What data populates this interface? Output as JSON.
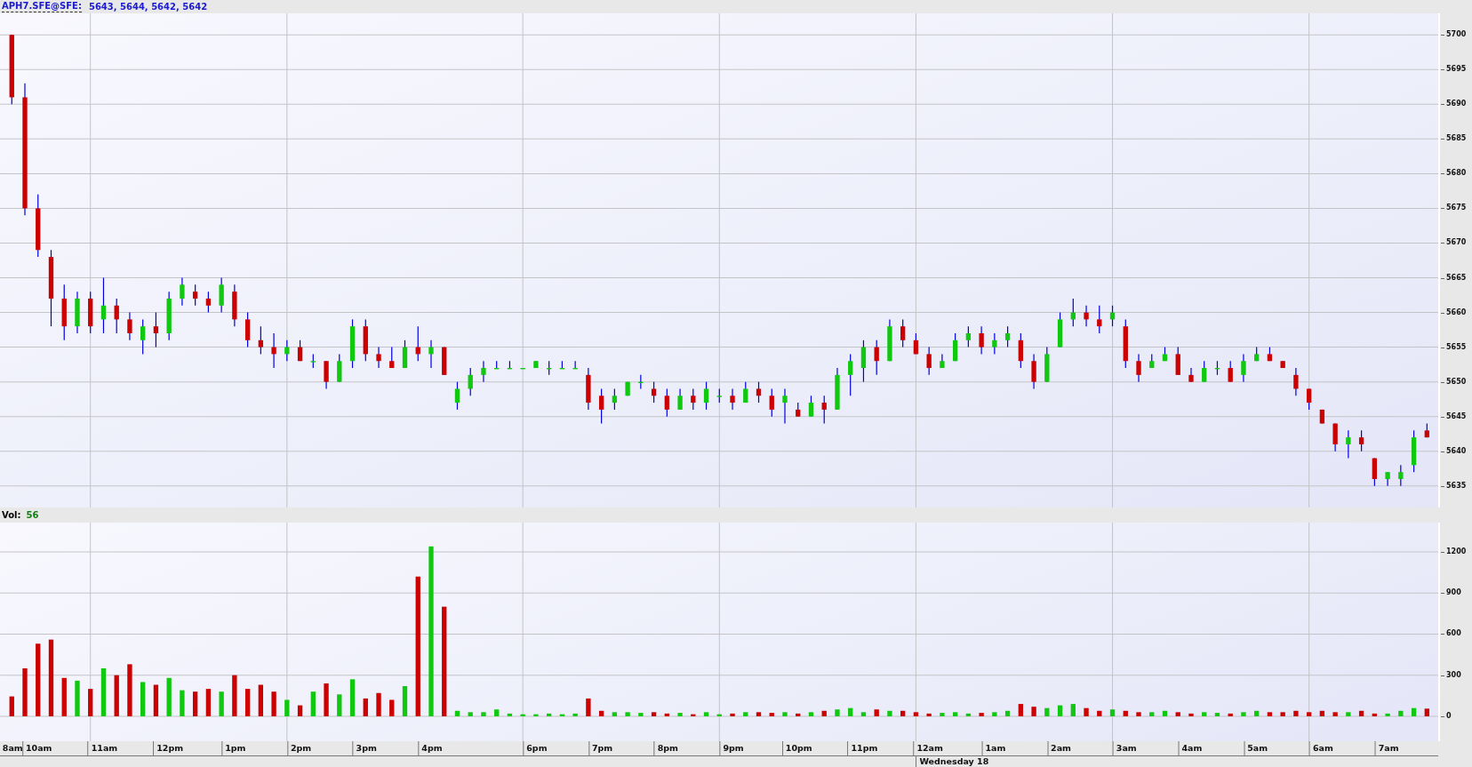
{
  "header": {
    "symbol": "APH7.SFE@SFE:",
    "quote": "5643, 5644, 5642, 5642"
  },
  "price_chart": {
    "chart_data": {
      "type": "candlestick",
      "ylim": [
        5631.9,
        5703.1
      ],
      "yticks": [
        5635,
        5640,
        5645,
        5650,
        5655,
        5660,
        5665,
        5670,
        5675,
        5680,
        5685,
        5690,
        5695,
        5700
      ],
      "grid": true,
      "categories": [
        null,
        null,
        null,
        null,
        null,
        null,
        null,
        null,
        null,
        null,
        null,
        null,
        null,
        null,
        null,
        null,
        null,
        null,
        null,
        null,
        null,
        null,
        null,
        null,
        null,
        null,
        null,
        null,
        null,
        null,
        null,
        null,
        null,
        null,
        null,
        null,
        null,
        null,
        null,
        null,
        null,
        null,
        null,
        null,
        null,
        null,
        null,
        null,
        null,
        null,
        null,
        null,
        null,
        null,
        null,
        null,
        null,
        null,
        null,
        null,
        null,
        null,
        null,
        null,
        null,
        null,
        null,
        null,
        null,
        null,
        null,
        null,
        null,
        null,
        null,
        null,
        null,
        null,
        null,
        null,
        null,
        null,
        null,
        null,
        null,
        null,
        null,
        null,
        null,
        null,
        null,
        null,
        null,
        null,
        null,
        null,
        null,
        null,
        null,
        null,
        null,
        null,
        null,
        null,
        null,
        null,
        null,
        null,
        null
      ],
      "ohlc": [
        [
          5700,
          5700,
          5690,
          5691
        ],
        [
          5691,
          5693,
          5674,
          5675
        ],
        [
          5675,
          5677,
          5668,
          5669
        ],
        [
          5668,
          5669,
          5658,
          5662
        ],
        [
          5662,
          5664,
          5656,
          5658
        ],
        [
          5658,
          5663,
          5657,
          5662
        ],
        [
          5662,
          5663,
          5657,
          5658
        ],
        [
          5659,
          5665,
          5657,
          5661
        ],
        [
          5661,
          5662,
          5657,
          5659
        ],
        [
          5659,
          5660,
          5656,
          5657
        ],
        [
          5656,
          5659,
          5654,
          5658
        ],
        [
          5658,
          5660,
          5655,
          5657
        ],
        [
          5657,
          5663,
          5656,
          5662
        ],
        [
          5662,
          5665,
          5661,
          5664
        ],
        [
          5663,
          5664,
          5661,
          5662
        ],
        [
          5662,
          5663,
          5660,
          5661
        ],
        [
          5661,
          5665,
          5660,
          5664
        ],
        [
          5663,
          5664,
          5658,
          5659
        ],
        [
          5659,
          5660,
          5655,
          5656
        ],
        [
          5656,
          5658,
          5654,
          5655
        ],
        [
          5655,
          5657,
          5652,
          5654
        ],
        [
          5654,
          5656,
          5653,
          5655
        ],
        [
          5655,
          5656,
          5653,
          5653
        ],
        [
          5653,
          5654,
          5652,
          5653
        ],
        [
          5653,
          5653,
          5649,
          5650
        ],
        [
          5650,
          5654,
          5650,
          5653
        ],
        [
          5653,
          5659,
          5652,
          5658
        ],
        [
          5658,
          5659,
          5653,
          5654
        ],
        [
          5654,
          5655,
          5652,
          5653
        ],
        [
          5653,
          5655,
          5652,
          5652
        ],
        [
          5652,
          5656,
          5652,
          5655
        ],
        [
          5655,
          5658,
          5653,
          5654
        ],
        [
          5654,
          5656,
          5652,
          5655
        ],
        [
          5655,
          5655,
          5651,
          5651
        ],
        [
          5647,
          5650,
          5646,
          5649
        ],
        [
          5649,
          5652,
          5648,
          5651
        ],
        [
          5651,
          5653,
          5650,
          5652
        ],
        [
          5652,
          5653,
          5652,
          5652
        ],
        [
          5652,
          5653,
          5652,
          5652
        ],
        [
          5652,
          5652,
          5652,
          5652
        ],
        [
          5652,
          5653,
          5652,
          5653
        ],
        [
          5652,
          5653,
          5651,
          5652
        ],
        [
          5652,
          5653,
          5652,
          5652
        ],
        [
          5652,
          5653,
          5652,
          5652
        ],
        [
          5651,
          5652,
          5646,
          5647
        ],
        [
          5648,
          5649,
          5644,
          5646
        ],
        [
          5647,
          5649,
          5646,
          5648
        ],
        [
          5648,
          5650,
          5648,
          5650
        ],
        [
          5650,
          5651,
          5649,
          5650
        ],
        [
          5649,
          5650,
          5647,
          5648
        ],
        [
          5648,
          5649,
          5645,
          5646
        ],
        [
          5646,
          5649,
          5646,
          5648
        ],
        [
          5648,
          5649,
          5646,
          5647
        ],
        [
          5647,
          5650,
          5646,
          5649
        ],
        [
          5648,
          5649,
          5647,
          5648
        ],
        [
          5648,
          5649,
          5646,
          5647
        ],
        [
          5647,
          5650,
          5647,
          5649
        ],
        [
          5649,
          5650,
          5647,
          5648
        ],
        [
          5648,
          5649,
          5645,
          5646
        ],
        [
          5647,
          5649,
          5644,
          5648
        ],
        [
          5646,
          5647,
          5645,
          5645
        ],
        [
          5645,
          5648,
          5645,
          5647
        ],
        [
          5647,
          5648,
          5644,
          5646
        ],
        [
          5646,
          5652,
          5646,
          5651
        ],
        [
          5651,
          5654,
          5648,
          5653
        ],
        [
          5652,
          5656,
          5650,
          5655
        ],
        [
          5655,
          5656,
          5651,
          5653
        ],
        [
          5653,
          5659,
          5653,
          5658
        ],
        [
          5658,
          5659,
          5655,
          5656
        ],
        [
          5656,
          5657,
          5654,
          5654
        ],
        [
          5654,
          5655,
          5651,
          5652
        ],
        [
          5652,
          5654,
          5652,
          5653
        ],
        [
          5653,
          5657,
          5653,
          5656
        ],
        [
          5656,
          5658,
          5655,
          5657
        ],
        [
          5657,
          5658,
          5654,
          5655
        ],
        [
          5655,
          5657,
          5654,
          5656
        ],
        [
          5656,
          5658,
          5655,
          5657
        ],
        [
          5656,
          5657,
          5652,
          5653
        ],
        [
          5653,
          5654,
          5649,
          5650
        ],
        [
          5650,
          5655,
          5650,
          5654
        ],
        [
          5655,
          5660,
          5655,
          5659
        ],
        [
          5659,
          5662,
          5658,
          5660
        ],
        [
          5660,
          5661,
          5658,
          5659
        ],
        [
          5659,
          5661,
          5657,
          5658
        ],
        [
          5659,
          5661,
          5658,
          5660
        ],
        [
          5658,
          5659,
          5652,
          5653
        ],
        [
          5653,
          5654,
          5650,
          5651
        ],
        [
          5652,
          5654,
          5652,
          5653
        ],
        [
          5653,
          5655,
          5653,
          5654
        ],
        [
          5654,
          5655,
          5651,
          5651
        ],
        [
          5651,
          5652,
          5650,
          5650
        ],
        [
          5650,
          5653,
          5650,
          5652
        ],
        [
          5652,
          5653,
          5651,
          5652
        ],
        [
          5652,
          5653,
          5650,
          5650
        ],
        [
          5651,
          5654,
          5650,
          5653
        ],
        [
          5653,
          5655,
          5653,
          5654
        ],
        [
          5654,
          5655,
          5653,
          5653
        ],
        [
          5653,
          5653,
          5652,
          5652
        ],
        [
          5651,
          5652,
          5648,
          5649
        ],
        [
          5649,
          5649,
          5646,
          5647
        ],
        [
          5646,
          5646,
          5644,
          5644
        ],
        [
          5644,
          5644,
          5640,
          5641
        ],
        [
          5641,
          5643,
          5639,
          5642
        ],
        [
          5642,
          5643,
          5640,
          5641
        ],
        [
          5639,
          5639,
          5635,
          5636
        ],
        [
          5636,
          5637,
          5635,
          5637
        ],
        [
          5636,
          5638,
          5635,
          5637
        ],
        [
          5638,
          5643,
          5637,
          5642
        ],
        [
          5643,
          5644,
          5642,
          5642
        ]
      ]
    }
  },
  "volume_header": {
    "label": "Vol:",
    "value": "56"
  },
  "volume_chart": {
    "chart_data": {
      "type": "bar",
      "ylim": [
        -182,
        1414
      ],
      "yticks": [
        0,
        300,
        600,
        900,
        1200
      ],
      "grid": true,
      "categories": [
        "8am",
        null,
        "10am",
        null,
        null,
        null,
        null,
        "11am",
        null,
        null,
        null,
        null,
        "12pm",
        null,
        null,
        null,
        null,
        "1pm",
        null,
        null,
        null,
        null,
        "2pm",
        null,
        null,
        null,
        null,
        "3pm",
        null,
        null,
        null,
        null,
        "4pm",
        null,
        null,
        null,
        null,
        null,
        null,
        null,
        "6pm",
        null,
        null,
        null,
        null,
        "7pm",
        null,
        null,
        null,
        null,
        "8pm",
        null,
        null,
        null,
        null,
        "9pm",
        null,
        null,
        null,
        null,
        "10pm",
        null,
        null,
        null,
        null,
        "11pm",
        null,
        null,
        null,
        null,
        "12am",
        null,
        null,
        null,
        null,
        "1am",
        null,
        null,
        null,
        null,
        "2am",
        null,
        null,
        null,
        null,
        "3am",
        null,
        null,
        null,
        null,
        "4am",
        null,
        null,
        null,
        null,
        "5am",
        null,
        null,
        null,
        null,
        "6am",
        null,
        null,
        null,
        null,
        "7am",
        null,
        null,
        null
      ],
      "values": [
        145,
        350,
        530,
        560,
        280,
        260,
        200,
        350,
        300,
        380,
        250,
        230,
        280,
        190,
        180,
        200,
        180,
        300,
        200,
        230,
        180,
        120,
        80,
        180,
        240,
        160,
        270,
        130,
        170,
        120,
        220,
        1020,
        1240,
        800,
        40,
        30,
        30,
        50,
        20,
        15,
        15,
        20,
        15,
        20,
        130,
        40,
        30,
        30,
        25,
        30,
        20,
        25,
        15,
        30,
        15,
        20,
        30,
        30,
        25,
        30,
        20,
        30,
        40,
        50,
        60,
        30,
        50,
        40,
        40,
        30,
        20,
        25,
        30,
        20,
        25,
        30,
        40,
        90,
        70,
        60,
        80,
        90,
        60,
        40,
        50,
        40,
        30,
        30,
        40,
        30,
        20,
        30,
        25,
        20,
        30,
        40,
        30,
        30,
        40,
        30,
        40,
        30,
        30,
        40,
        20,
        20,
        40,
        60,
        56
      ]
    }
  },
  "day_label": "Wednesday 18"
}
